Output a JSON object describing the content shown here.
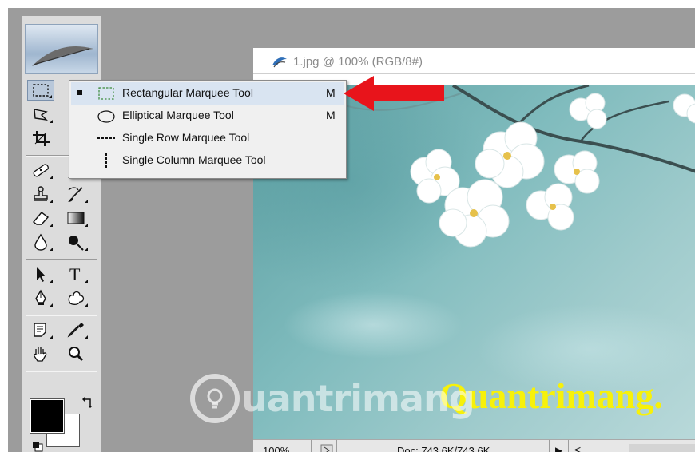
{
  "document": {
    "title": "1.jpg @ 100% (RGB/8#)",
    "watermark_text": "Quantrimang.",
    "logo_text": "uantrimang"
  },
  "statusbar": {
    "zoom": "100%",
    "doc_info": "Doc: 743.6K/743.6K",
    "nav_arrow": "▶",
    "scroll_left": "<"
  },
  "flyout": {
    "items": [
      {
        "label": "Rectangular Marquee Tool",
        "shortcut": "M",
        "icon": "rect-marquee-icon",
        "selected": true
      },
      {
        "label": "Elliptical Marquee Tool",
        "shortcut": "M",
        "icon": "ellipse-marquee-icon",
        "selected": false
      },
      {
        "label": "Single Row Marquee Tool",
        "shortcut": "",
        "icon": "single-row-marquee-icon",
        "selected": false
      },
      {
        "label": "Single Column Marquee Tool",
        "shortcut": "",
        "icon": "single-column-marquee-icon",
        "selected": false
      }
    ]
  },
  "toolbox": {
    "tools": [
      "marquee-icon",
      "move-icon",
      "lasso-icon",
      "magic-wand-icon",
      "crop-icon",
      "slice-icon",
      "healing-brush-icon",
      "brush-icon",
      "clone-stamp-icon",
      "history-brush-icon",
      "eraser-icon",
      "gradient-icon",
      "blur-icon",
      "dodge-icon",
      "path-selection-icon",
      "type-icon",
      "pen-icon",
      "custom-shape-icon",
      "notes-icon",
      "eyedropper-icon",
      "hand-icon",
      "zoom-icon"
    ]
  },
  "colors": {
    "annotation_arrow": "#e8141b",
    "watermark_yellow": "#f7f10a",
    "foreground": "#000000",
    "background": "#ffffff"
  }
}
